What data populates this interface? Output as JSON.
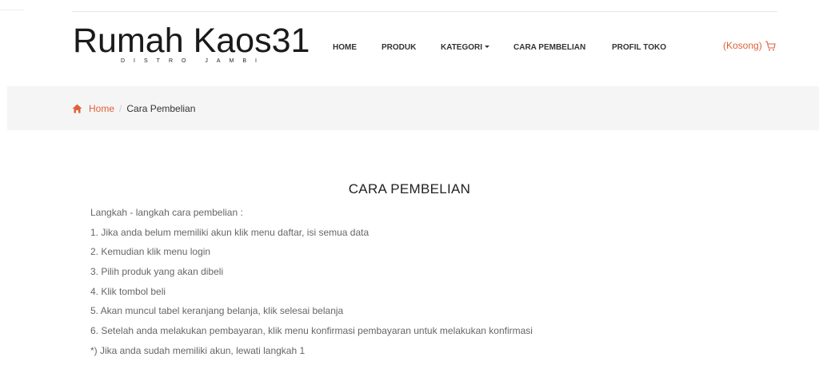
{
  "logo": {
    "title": "Rumah Kaos31",
    "subtitle": "DISTRO JAMBI"
  },
  "nav": {
    "items": [
      {
        "label": "HOME"
      },
      {
        "label": "PRODUK"
      },
      {
        "label": "KATEGORI"
      },
      {
        "label": "CARA PEMBELIAN"
      },
      {
        "label": "PROFIL TOKO"
      }
    ]
  },
  "cart": {
    "label": "(Kosong)",
    "icon": "cart-icon"
  },
  "breadcrumb": {
    "home_label": "Home",
    "separator": "/",
    "current": "Cara Pembelian",
    "home_icon": "home-icon"
  },
  "content": {
    "title": "CARA PEMBELIAN",
    "lines": [
      "Langkah - langkah cara pembelian :",
      "1. Jika anda belum memiliki akun klik menu daftar, isi semua data",
      "2. Kemudian klik menu login",
      "3. Pilih produk yang akan dibeli",
      "4. Klik tombol beli",
      "5. Akan muncul tabel keranjang belanja, klik selesai belanja",
      "6. Setelah anda melakukan pembayaran, klik menu konfirmasi pembayaran untuk melakukan konfirmasi",
      "*) Jika anda sudah memiliki akun, lewati langkah 1"
    ]
  },
  "colors": {
    "accent": "#e0603a",
    "breadcrumb_bg": "#f5f5f5",
    "text": "#666666"
  }
}
